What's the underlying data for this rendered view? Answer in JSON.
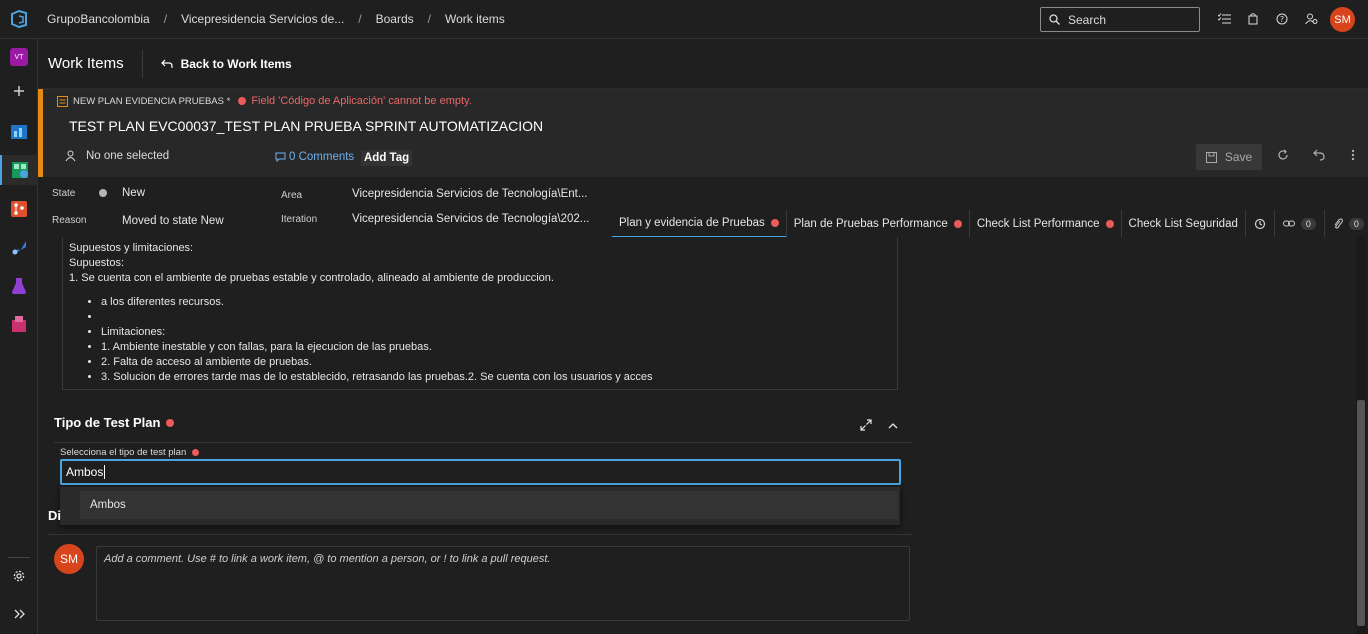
{
  "topbar": {
    "breadcrumbs": [
      "GrupoBancolombia",
      "Vicepresidencia Servicios de...",
      "Boards",
      "Work items"
    ],
    "search_placeholder": "Search",
    "user_initials": "SM"
  },
  "leftnav": {
    "project_initials": "VT"
  },
  "header": {
    "title": "Work Items",
    "back_label": "Back to Work Items"
  },
  "work_item": {
    "type_label": "NEW PLAN EVIDENCIA PRUEBAS *",
    "error_message": "Field 'Código de Aplicación' cannot be empty.",
    "title": "TEST PLAN EVC00037_TEST PLAN PRUEBA SPRINT AUTOMATIZACION",
    "assigned_to": "No one selected",
    "comments_label": "0 Comments",
    "add_tag_label": "Add Tag",
    "save_label": "Save"
  },
  "fields": {
    "state_label": "State",
    "state_value": "New",
    "reason_label": "Reason",
    "reason_value": "Moved to state New",
    "area_label": "Area",
    "area_value": "Vicepresidencia Servicios de Tecnología\\Ent...",
    "iteration_label": "Iteration",
    "iteration_value": "Vicepresidencia Servicios de Tecnología\\202..."
  },
  "tabs": [
    {
      "label": "Plan y evidencia de Pruebas",
      "error": true
    },
    {
      "label": "Plan de Pruebas Performance",
      "error": true
    },
    {
      "label": "Check List Performance",
      "error": true
    },
    {
      "label": "Check List Seguridad",
      "error": false
    }
  ],
  "tab_counts": {
    "links": "0",
    "attachments": "0"
  },
  "rich_text": {
    "line1": "Supuestos y limitaciones:",
    "line2": "Supuestos:",
    "line3": "1. Se cuenta con el ambiente de pruebas estable y controlado, alineado al ambiente de produccion.",
    "bullet1": "a los diferentes recursos.",
    "bullet2": "",
    "bullet3": "Limitaciones:",
    "bullet4": "1. Ambiente inestable y con fallas, para la ejecucion de las pruebas.",
    "bullet5": "2. Falta de acceso al ambiente de pruebas.",
    "bullet6": "3. Solucion de errores tarde mas de lo establecido, retrasando las pruebas.2. Se cuenta con los usuarios y acces"
  },
  "test_plan": {
    "section_title": "Tipo de Test Plan",
    "select_label": "Selecciona el tipo de test plan",
    "input_value": "Ambos",
    "dropdown_option": "Ambos"
  },
  "discussion": {
    "label": "Di",
    "user_initials": "SM",
    "placeholder": "Add a comment. Use # to link a work item, @ to mention a person, or ! to link a pull request."
  },
  "colors": {
    "accent": "#4aa3e2",
    "error": "#ec5b5b",
    "work_item_color": "#e58a16",
    "avatar": "#d8451d"
  }
}
